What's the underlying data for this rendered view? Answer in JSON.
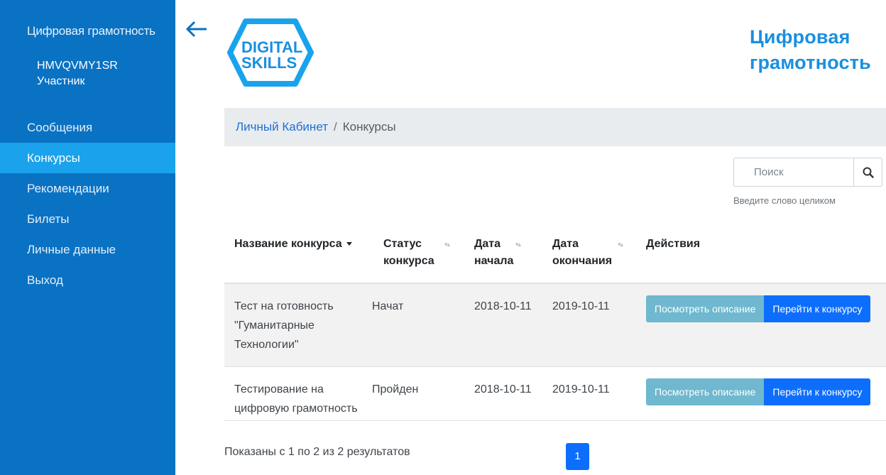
{
  "sidebar": {
    "app_title": "Цифровая грамотность",
    "user_id": "HMVQVMY1SR",
    "user_role": "Участник",
    "items": [
      {
        "label": "Сообщения"
      },
      {
        "label": "Конкурсы",
        "active": true
      },
      {
        "label": "Рекомендации"
      },
      {
        "label": "Билеты"
      },
      {
        "label": "Личные данные"
      },
      {
        "label": "Выход"
      }
    ]
  },
  "header": {
    "logo_line1": "DIGITAL",
    "logo_line2": "SKILLS",
    "brand_title_line1": "Цифровая",
    "brand_title_line2": "грамотность"
  },
  "breadcrumb": {
    "home": "Личный Кабинет",
    "separator": "/",
    "current": "Конкурсы"
  },
  "search": {
    "placeholder": "Поиск",
    "hint": "Введите слово целиком"
  },
  "table": {
    "headers": {
      "name": "Название конкурса",
      "status_line1": "Статус",
      "status_line2": "конкурса",
      "start_line1": "Дата",
      "start_line2": "начала",
      "end_line1": "Дата",
      "end_line2": "окончания",
      "actions": "Действия"
    },
    "rows": [
      {
        "name": "Тест на готовность \"Гуманитарные Технологии\"",
        "status": "Начат",
        "start": "2018-10-11",
        "end": "2019-10-11",
        "btn_view": "Посмотреть описание",
        "btn_go": "Перейти к конкурсу"
      },
      {
        "name": "Тестирование на цифровую грамотность",
        "status": "Пройден",
        "start": "2018-10-11",
        "end": "2019-10-11",
        "btn_view": "Посмотреть описание",
        "btn_go": "Перейти к конкурсу"
      }
    ]
  },
  "footer": {
    "results_text": "Показаны с 1 по 2 из 2 результатов",
    "current_page": "1"
  },
  "colors": {
    "sidebar_bg": "#0a72c3",
    "sidebar_active": "#1aa3ec",
    "brand": "#1a8fe0",
    "btn_info": "#6fb8cf",
    "btn_primary": "#0d6efd"
  },
  "icons": {
    "back": "arrow-left-icon",
    "search": "search-icon",
    "sort": "sort-icon"
  }
}
